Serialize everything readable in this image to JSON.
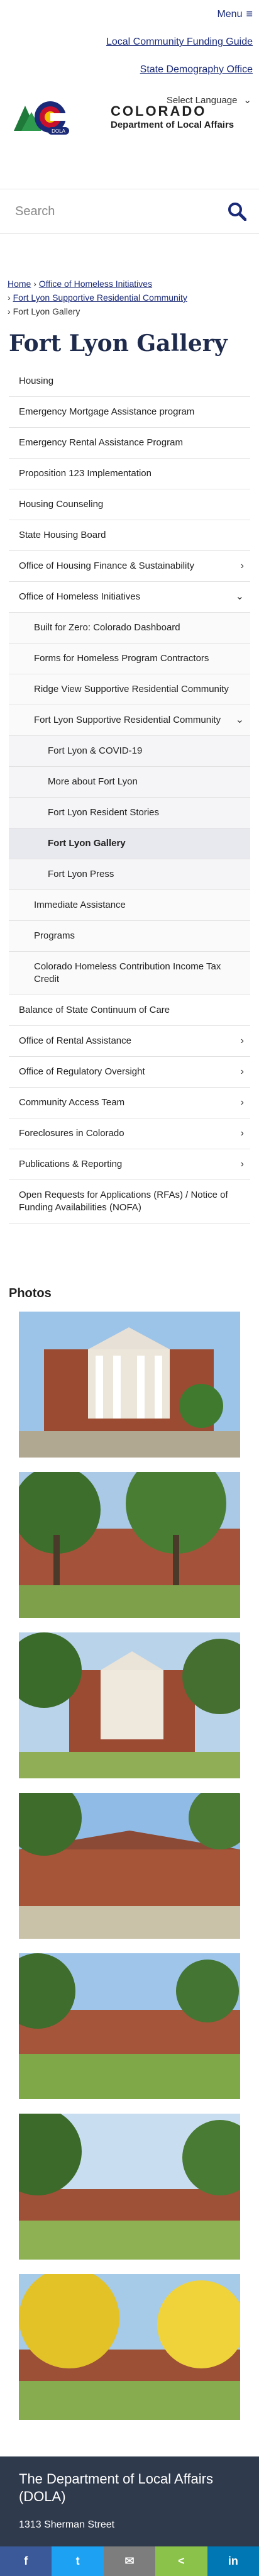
{
  "header": {
    "menu_label": "Menu",
    "links": [
      "Local Community Funding Guide",
      "State Demography Office"
    ],
    "language_label": "Select Language",
    "logo": {
      "state": "COLORADO",
      "department": "Department of Local Affairs",
      "badge": "DOLA"
    }
  },
  "search": {
    "placeholder": "Search"
  },
  "breadcrumb": {
    "home": "Home",
    "level1": "Office of Homeless Initiatives",
    "level2": "Fort Lyon Supportive Residential Community",
    "current": "Fort Lyon Gallery"
  },
  "page_title": "Fort Lyon Gallery",
  "nav": [
    {
      "label": "Housing",
      "level": 0,
      "chevron": ""
    },
    {
      "label": "Emergency Mortgage Assistance program",
      "level": 0,
      "chevron": ""
    },
    {
      "label": "Emergency Rental Assistance Program",
      "level": 0,
      "chevron": ""
    },
    {
      "label": "Proposition 123 Implementation",
      "level": 0,
      "chevron": ""
    },
    {
      "label": "Housing Counseling",
      "level": 0,
      "chevron": ""
    },
    {
      "label": "State Housing Board",
      "level": 0,
      "chevron": ""
    },
    {
      "label": "Office of Housing Finance & Sustainability",
      "level": 0,
      "chevron": "right"
    },
    {
      "label": "Office of Homeless Initiatives",
      "level": 0,
      "chevron": "down"
    },
    {
      "label": "Built for Zero: Colorado Dashboard",
      "level": 1,
      "chevron": ""
    },
    {
      "label": "Forms for Homeless Program Contractors",
      "level": 1,
      "chevron": ""
    },
    {
      "label": "Ridge View Supportive Residential Community",
      "level": 1,
      "chevron": ""
    },
    {
      "label": "Fort Lyon Supportive Residential Community",
      "level": 1,
      "chevron": "down"
    },
    {
      "label": "Fort Lyon & COVID-19",
      "level": 2,
      "chevron": ""
    },
    {
      "label": "More about Fort Lyon",
      "level": 2,
      "chevron": ""
    },
    {
      "label": "Fort Lyon Resident Stories",
      "level": 2,
      "chevron": ""
    },
    {
      "label": "Fort Lyon Gallery",
      "level": 2,
      "chevron": "",
      "active": true
    },
    {
      "label": "Fort Lyon Press",
      "level": 2,
      "chevron": ""
    },
    {
      "label": "Immediate Assistance",
      "level": 1,
      "chevron": ""
    },
    {
      "label": "Programs",
      "level": 1,
      "chevron": ""
    },
    {
      "label": "Colorado Homeless Contribution Income Tax Credit",
      "level": 1,
      "chevron": ""
    },
    {
      "label": "Balance of State Continuum of Care",
      "level": 0,
      "chevron": ""
    },
    {
      "label": "Office of Rental Assistance",
      "level": 0,
      "chevron": "right"
    },
    {
      "label": "Office of Regulatory Oversight",
      "level": 0,
      "chevron": "right"
    },
    {
      "label": "Community Access Team",
      "level": 0,
      "chevron": "right"
    },
    {
      "label": "Foreclosures in Colorado",
      "level": 0,
      "chevron": "right"
    },
    {
      "label": "Publications & Reporting",
      "level": 0,
      "chevron": "right"
    },
    {
      "label": "Open Requests for Applications (RFAs) / Notice of Funding Availabilities (NOFA)",
      "level": 0,
      "chevron": ""
    }
  ],
  "photos_heading": "Photos",
  "photos": [
    {
      "scene": "portico-building"
    },
    {
      "scene": "trees-building"
    },
    {
      "scene": "portico-trees"
    },
    {
      "scene": "long-building"
    },
    {
      "scene": "lawn-building"
    },
    {
      "scene": "far-building"
    },
    {
      "scene": "autumn-trees"
    }
  ],
  "footer": {
    "dept_name": "The Department of Local Affairs (DOLA)",
    "address": "1313 Sherman Street"
  },
  "share": [
    {
      "name": "facebook",
      "glyph": "f",
      "color": "#3b5998"
    },
    {
      "name": "twitter",
      "glyph": "t",
      "color": "#1da1f2"
    },
    {
      "name": "email",
      "glyph": "✉",
      "color": "#7d7d7d"
    },
    {
      "name": "share",
      "glyph": "<",
      "color": "#8bc34a"
    },
    {
      "name": "linkedin",
      "glyph": "in",
      "color": "#0077b5"
    }
  ]
}
